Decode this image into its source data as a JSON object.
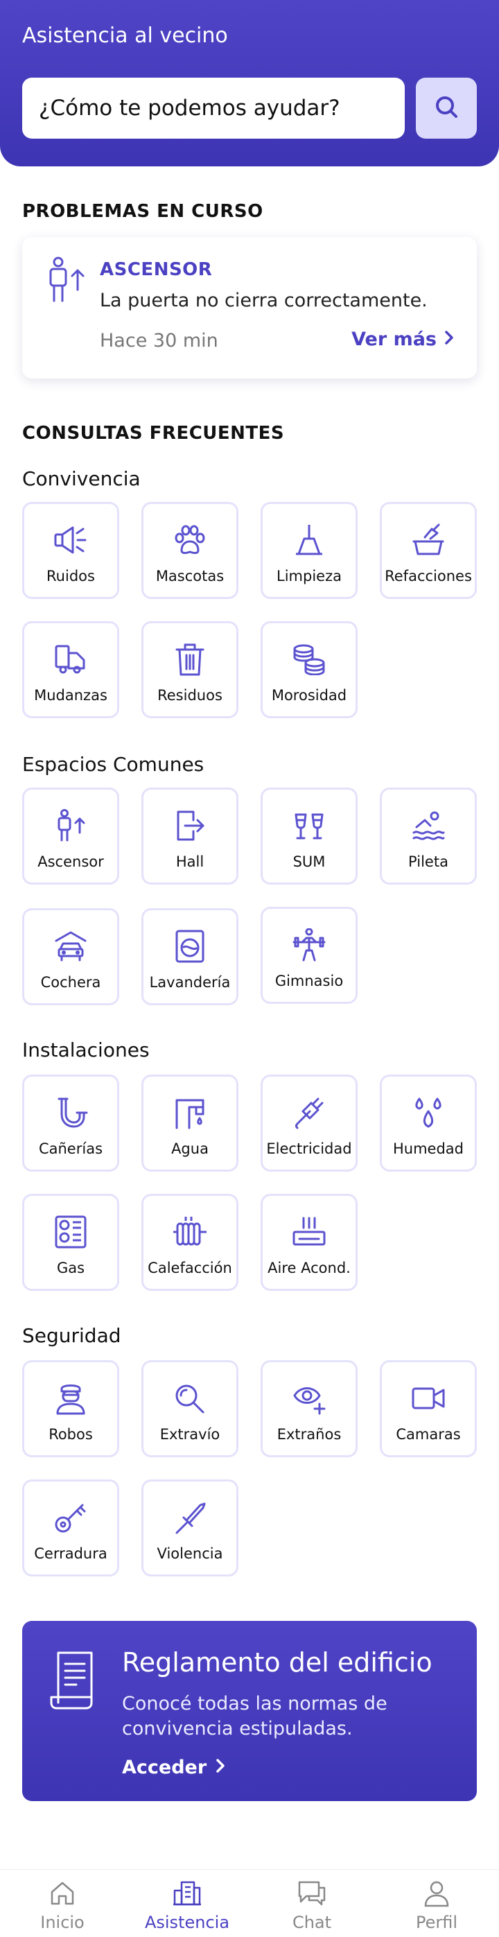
{
  "header": {
    "title": "Asistencia al vecino",
    "search_placeholder": "¿Cómo te podemos ayudar?",
    "search_icon": "search-icon"
  },
  "problems": {
    "section_title": "PROBLEMAS EN CURSO",
    "card": {
      "icon": "elevator-icon",
      "category": "ASCENSOR",
      "description": "La puerta no cierra correctamente.",
      "time": "Hace 30 min",
      "more": "Ver más"
    }
  },
  "faq": {
    "section_title": "CONSULTAS FRECUENTES",
    "groups": [
      {
        "title": "Convivencia",
        "items": [
          {
            "label": "Ruidos",
            "icon": "megaphone-icon"
          },
          {
            "label": "Mascotas",
            "icon": "paw-icon"
          },
          {
            "label": "Limpieza",
            "icon": "broom-icon"
          },
          {
            "label": "Refacciones",
            "icon": "trowel-icon"
          },
          {
            "label": "Mudanzas",
            "icon": "moving-truck-icon"
          },
          {
            "label": "Residuos",
            "icon": "trash-icon"
          },
          {
            "label": "Morosidad",
            "icon": "coins-icon"
          }
        ]
      },
      {
        "title": "Espacios Comunes",
        "items": [
          {
            "label": "Ascensor",
            "icon": "elevator-icon"
          },
          {
            "label": "Hall",
            "icon": "door-exit-icon"
          },
          {
            "label": "SUM",
            "icon": "glasses-cheers-icon"
          },
          {
            "label": "Pileta",
            "icon": "swimmer-icon"
          },
          {
            "label": "Cochera",
            "icon": "garage-car-icon"
          },
          {
            "label": "Lavandería",
            "icon": "washing-machine-icon"
          },
          {
            "label": "Gimnasio",
            "icon": "weightlifter-icon"
          }
        ]
      },
      {
        "title": "Instalaciones",
        "items": [
          {
            "label": "Cañerías",
            "icon": "pipe-icon"
          },
          {
            "label": "Agua",
            "icon": "faucet-icon"
          },
          {
            "label": "Electricidad",
            "icon": "plug-icon"
          },
          {
            "label": "Humedad",
            "icon": "droplets-icon"
          },
          {
            "label": "Gas",
            "icon": "gas-stove-icon"
          },
          {
            "label": "Calefacción",
            "icon": "radiator-icon"
          },
          {
            "label": "Aire Acond.",
            "icon": "air-conditioner-icon"
          }
        ]
      },
      {
        "title": "Seguridad",
        "items": [
          {
            "label": "Robos",
            "icon": "thief-icon"
          },
          {
            "label": "Extravío",
            "icon": "magnifier-icon"
          },
          {
            "label": "Extraños",
            "icon": "eye-plus-icon"
          },
          {
            "label": "Camaras",
            "icon": "video-camera-icon"
          },
          {
            "label": "Cerradura",
            "icon": "key-icon"
          },
          {
            "label": "Violencia",
            "icon": "knife-icon"
          }
        ]
      }
    ]
  },
  "banner": {
    "icon": "document-scroll-icon",
    "title": "Reglamento del edificio",
    "text": "Conocé todas las normas de convivencia estipuladas.",
    "cta": "Acceder"
  },
  "nav": {
    "items": [
      {
        "label": "Inicio",
        "icon": "home-icon",
        "active": false
      },
      {
        "label": "Asistencia",
        "icon": "building-icon",
        "active": true
      },
      {
        "label": "Chat",
        "icon": "chat-icon",
        "active": false
      },
      {
        "label": "Perfil",
        "icon": "user-icon",
        "active": false
      }
    ]
  },
  "colors": {
    "accent": "#4b41c2",
    "header": "#4f44c6",
    "tile_border": "#e4e2fb",
    "search_button": "#dcdafc"
  }
}
